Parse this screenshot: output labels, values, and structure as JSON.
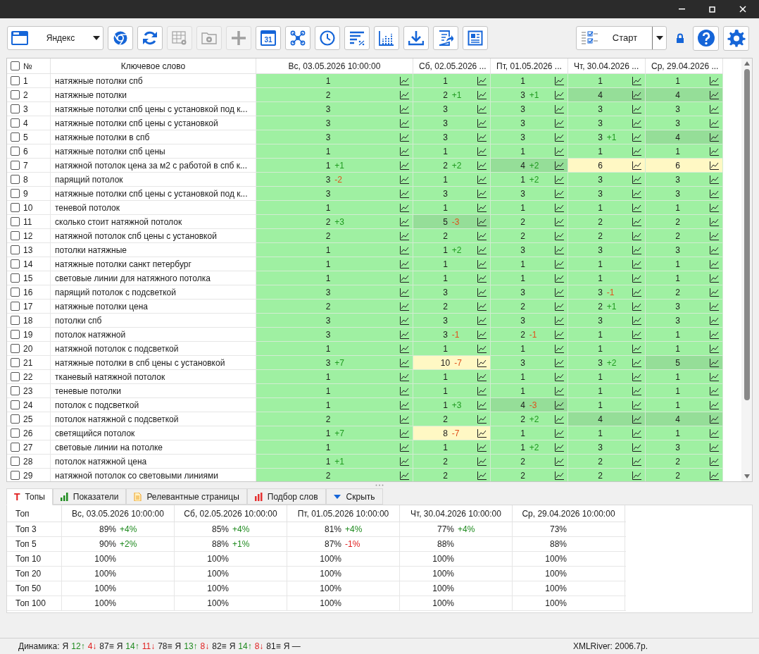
{
  "toolbar": {
    "engine": {
      "label": "Яндекс"
    },
    "buttons": [
      {
        "kind": "browser",
        "disabled": false
      },
      {
        "kind": "refresh",
        "disabled": false
      },
      {
        "kind": "table",
        "disabled": true
      },
      {
        "kind": "folder",
        "disabled": true
      },
      {
        "kind": "plus",
        "disabled": true
      },
      {
        "kind": "calendar",
        "label": "31",
        "disabled": false
      },
      {
        "kind": "network",
        "disabled": false
      },
      {
        "kind": "clock",
        "disabled": false
      },
      {
        "kind": "sort",
        "disabled": false
      },
      {
        "kind": "chart",
        "disabled": false
      },
      {
        "kind": "download",
        "disabled": false
      },
      {
        "kind": "export",
        "disabled": false
      },
      {
        "kind": "newspaper",
        "disabled": false
      }
    ],
    "start": {
      "label": "Старт"
    },
    "right_buttons": [
      {
        "kind": "help"
      },
      {
        "kind": "settings"
      }
    ]
  },
  "table": {
    "header_checked": false,
    "number_header": "№",
    "keyword_header": "Ключевое слово",
    "date_columns": [
      "Вс, 03.05.2026 10:00:00",
      "Сб, 02.05.2026 ...",
      "Пт, 01.05.2026 ...",
      "Чт, 30.04.2026 ...",
      "Ср, 29.04.2026 ..."
    ],
    "rows": [
      {
        "n": "1",
        "keyword": "натяжные потолки спб",
        "checked": false,
        "cells": [
          {
            "v": "1",
            "kind": "green"
          },
          {
            "v": "1",
            "kind": "green"
          },
          {
            "v": "1",
            "kind": "green"
          },
          {
            "v": "1",
            "kind": "green"
          },
          {
            "v": "1",
            "kind": "green"
          }
        ]
      },
      {
        "n": "2",
        "keyword": "натяжные потолки",
        "checked": false,
        "cells": [
          {
            "v": "2",
            "kind": "green"
          },
          {
            "v": "2",
            "d": "+1",
            "up": true,
            "kind": "green"
          },
          {
            "v": "3",
            "d": "+1",
            "up": true,
            "kind": "green"
          },
          {
            "v": "4",
            "kind": "dark"
          },
          {
            "v": "4",
            "kind": "dark"
          }
        ]
      },
      {
        "n": "3",
        "keyword": "натяжные потолки спб цены с установкой под к...",
        "checked": false,
        "cells": [
          {
            "v": "3",
            "kind": "green"
          },
          {
            "v": "3",
            "kind": "green"
          },
          {
            "v": "3",
            "kind": "green"
          },
          {
            "v": "3",
            "kind": "green"
          },
          {
            "v": "3",
            "kind": "green"
          }
        ]
      },
      {
        "n": "4",
        "keyword": "натяжные потолки спб цены с установкой",
        "checked": false,
        "cells": [
          {
            "v": "3",
            "kind": "green"
          },
          {
            "v": "3",
            "kind": "green"
          },
          {
            "v": "3",
            "kind": "green"
          },
          {
            "v": "3",
            "kind": "green"
          },
          {
            "v": "3",
            "kind": "green"
          }
        ]
      },
      {
        "n": "5",
        "keyword": "натяжные потолки в спб",
        "checked": false,
        "cells": [
          {
            "v": "3",
            "kind": "green"
          },
          {
            "v": "3",
            "kind": "green"
          },
          {
            "v": "3",
            "kind": "green"
          },
          {
            "v": "3",
            "d": "+1",
            "up": true,
            "kind": "green"
          },
          {
            "v": "4",
            "kind": "dark"
          }
        ]
      },
      {
        "n": "6",
        "keyword": "натяжные потолки спб цены",
        "checked": false,
        "cells": [
          {
            "v": "1",
            "kind": "green"
          },
          {
            "v": "1",
            "kind": "green"
          },
          {
            "v": "1",
            "kind": "green"
          },
          {
            "v": "1",
            "kind": "green"
          },
          {
            "v": "1",
            "kind": "green"
          }
        ]
      },
      {
        "n": "7",
        "keyword": "натяжной потолок цена за м2 с работой в спб к...",
        "checked": false,
        "cells": [
          {
            "v": "1",
            "d": "+1",
            "up": true,
            "kind": "green"
          },
          {
            "v": "2",
            "d": "+2",
            "up": true,
            "kind": "green"
          },
          {
            "v": "4",
            "d": "+2",
            "up": true,
            "kind": "dark"
          },
          {
            "v": "6",
            "kind": "yellow"
          },
          {
            "v": "6",
            "kind": "yellow"
          }
        ]
      },
      {
        "n": "8",
        "keyword": "парящий потолок",
        "checked": false,
        "cells": [
          {
            "v": "3",
            "d": "-2",
            "up": false,
            "kind": "green"
          },
          {
            "v": "1",
            "kind": "green"
          },
          {
            "v": "1",
            "d": "+2",
            "up": true,
            "kind": "green"
          },
          {
            "v": "3",
            "kind": "green"
          },
          {
            "v": "3",
            "kind": "green"
          }
        ]
      },
      {
        "n": "9",
        "keyword": "натяжные потолки спб цены с установкой под к...",
        "checked": false,
        "cells": [
          {
            "v": "3",
            "kind": "green"
          },
          {
            "v": "3",
            "kind": "green"
          },
          {
            "v": "3",
            "kind": "green"
          },
          {
            "v": "3",
            "kind": "green"
          },
          {
            "v": "3",
            "kind": "green"
          }
        ]
      },
      {
        "n": "10",
        "keyword": "теневой потолок",
        "checked": false,
        "cells": [
          {
            "v": "1",
            "kind": "green"
          },
          {
            "v": "1",
            "kind": "green"
          },
          {
            "v": "1",
            "kind": "green"
          },
          {
            "v": "1",
            "kind": "green"
          },
          {
            "v": "1",
            "kind": "green"
          }
        ]
      },
      {
        "n": "11",
        "keyword": "сколько стоит натяжной потолок",
        "checked": false,
        "cells": [
          {
            "v": "2",
            "d": "+3",
            "up": true,
            "kind": "green"
          },
          {
            "v": "5",
            "d": "-3",
            "up": false,
            "kind": "dark"
          },
          {
            "v": "2",
            "kind": "green"
          },
          {
            "v": "2",
            "kind": "green"
          },
          {
            "v": "2",
            "kind": "green"
          }
        ]
      },
      {
        "n": "12",
        "keyword": "натяжной потолок спб цены с установкой",
        "checked": false,
        "cells": [
          {
            "v": "2",
            "kind": "green"
          },
          {
            "v": "2",
            "kind": "green"
          },
          {
            "v": "2",
            "kind": "green"
          },
          {
            "v": "2",
            "kind": "green"
          },
          {
            "v": "2",
            "kind": "green"
          }
        ]
      },
      {
        "n": "13",
        "keyword": "потолки натяжные",
        "checked": false,
        "cells": [
          {
            "v": "1",
            "kind": "green"
          },
          {
            "v": "1",
            "d": "+2",
            "up": true,
            "kind": "green"
          },
          {
            "v": "3",
            "kind": "green"
          },
          {
            "v": "3",
            "kind": "green"
          },
          {
            "v": "3",
            "kind": "green"
          }
        ]
      },
      {
        "n": "14",
        "keyword": "натяжные потолки санкт петербург",
        "checked": false,
        "cells": [
          {
            "v": "1",
            "kind": "green"
          },
          {
            "v": "1",
            "kind": "green"
          },
          {
            "v": "1",
            "kind": "green"
          },
          {
            "v": "1",
            "kind": "green"
          },
          {
            "v": "1",
            "kind": "green"
          }
        ]
      },
      {
        "n": "15",
        "keyword": "световые линии для натяжного потолка",
        "checked": false,
        "cells": [
          {
            "v": "1",
            "kind": "green"
          },
          {
            "v": "1",
            "kind": "green"
          },
          {
            "v": "1",
            "kind": "green"
          },
          {
            "v": "1",
            "kind": "green"
          },
          {
            "v": "1",
            "kind": "green"
          }
        ]
      },
      {
        "n": "16",
        "keyword": "парящий потолок с подсветкой",
        "checked": false,
        "cells": [
          {
            "v": "3",
            "kind": "green"
          },
          {
            "v": "3",
            "kind": "green"
          },
          {
            "v": "3",
            "kind": "green"
          },
          {
            "v": "3",
            "d": "-1",
            "up": false,
            "kind": "green"
          },
          {
            "v": "2",
            "kind": "green"
          }
        ]
      },
      {
        "n": "17",
        "keyword": "натяжные потолки цена",
        "checked": false,
        "cells": [
          {
            "v": "2",
            "kind": "green"
          },
          {
            "v": "2",
            "kind": "green"
          },
          {
            "v": "2",
            "kind": "green"
          },
          {
            "v": "2",
            "d": "+1",
            "up": true,
            "kind": "green"
          },
          {
            "v": "3",
            "kind": "green"
          }
        ]
      },
      {
        "n": "18",
        "keyword": "потолки спб",
        "checked": false,
        "cells": [
          {
            "v": "3",
            "kind": "green"
          },
          {
            "v": "3",
            "kind": "green"
          },
          {
            "v": "3",
            "kind": "green"
          },
          {
            "v": "3",
            "kind": "green"
          },
          {
            "v": "3",
            "kind": "green"
          }
        ]
      },
      {
        "n": "19",
        "keyword": "потолок натяжной",
        "checked": false,
        "cells": [
          {
            "v": "3",
            "kind": "green"
          },
          {
            "v": "3",
            "d": "-1",
            "up": false,
            "kind": "green"
          },
          {
            "v": "2",
            "d": "-1",
            "up": false,
            "kind": "green"
          },
          {
            "v": "1",
            "kind": "green"
          },
          {
            "v": "1",
            "kind": "green"
          }
        ]
      },
      {
        "n": "20",
        "keyword": "натяжной потолок с подсветкой",
        "checked": false,
        "cells": [
          {
            "v": "1",
            "kind": "green"
          },
          {
            "v": "1",
            "kind": "green"
          },
          {
            "v": "1",
            "kind": "green"
          },
          {
            "v": "1",
            "kind": "green"
          },
          {
            "v": "1",
            "kind": "green"
          }
        ]
      },
      {
        "n": "21",
        "keyword": "натяжные потолки в спб цены с установкой",
        "checked": false,
        "cells": [
          {
            "v": "3",
            "d": "+7",
            "up": true,
            "kind": "green"
          },
          {
            "v": "10",
            "d": "-7",
            "up": false,
            "kind": "yellow"
          },
          {
            "v": "3",
            "kind": "green"
          },
          {
            "v": "3",
            "d": "+2",
            "up": true,
            "kind": "green"
          },
          {
            "v": "5",
            "kind": "dark"
          }
        ]
      },
      {
        "n": "22",
        "keyword": "тканевый натяжной потолок",
        "checked": false,
        "cells": [
          {
            "v": "1",
            "kind": "green"
          },
          {
            "v": "1",
            "kind": "green"
          },
          {
            "v": "1",
            "kind": "green"
          },
          {
            "v": "1",
            "kind": "green"
          },
          {
            "v": "1",
            "kind": "green"
          }
        ]
      },
      {
        "n": "23",
        "keyword": "теневые потолки",
        "checked": false,
        "cells": [
          {
            "v": "1",
            "kind": "green"
          },
          {
            "v": "1",
            "kind": "green"
          },
          {
            "v": "1",
            "kind": "green"
          },
          {
            "v": "1",
            "kind": "green"
          },
          {
            "v": "1",
            "kind": "green"
          }
        ]
      },
      {
        "n": "24",
        "keyword": "потолок с подсветкой",
        "checked": false,
        "cells": [
          {
            "v": "1",
            "kind": "green"
          },
          {
            "v": "1",
            "d": "+3",
            "up": true,
            "kind": "green"
          },
          {
            "v": "4",
            "d": "-3",
            "up": false,
            "kind": "dark"
          },
          {
            "v": "1",
            "kind": "green"
          },
          {
            "v": "1",
            "kind": "green"
          }
        ]
      },
      {
        "n": "25",
        "keyword": "потолок натяжной с подсветкой",
        "checked": false,
        "cells": [
          {
            "v": "2",
            "kind": "green"
          },
          {
            "v": "2",
            "kind": "green"
          },
          {
            "v": "2",
            "d": "+2",
            "up": true,
            "kind": "green"
          },
          {
            "v": "4",
            "kind": "dark"
          },
          {
            "v": "4",
            "kind": "dark"
          }
        ]
      },
      {
        "n": "26",
        "keyword": "светящийся потолок",
        "checked": false,
        "cells": [
          {
            "v": "1",
            "d": "+7",
            "up": true,
            "kind": "green"
          },
          {
            "v": "8",
            "d": "-7",
            "up": false,
            "kind": "yellow"
          },
          {
            "v": "1",
            "kind": "green"
          },
          {
            "v": "1",
            "kind": "green"
          },
          {
            "v": "1",
            "kind": "green"
          }
        ]
      },
      {
        "n": "27",
        "keyword": "световые линии на потолке",
        "checked": false,
        "cells": [
          {
            "v": "1",
            "kind": "green"
          },
          {
            "v": "1",
            "kind": "green"
          },
          {
            "v": "1",
            "d": "+2",
            "up": true,
            "kind": "green"
          },
          {
            "v": "3",
            "kind": "green"
          },
          {
            "v": "3",
            "kind": "green"
          }
        ]
      },
      {
        "n": "28",
        "keyword": "потолок натяжной цена",
        "checked": false,
        "cells": [
          {
            "v": "1",
            "d": "+1",
            "up": true,
            "kind": "green"
          },
          {
            "v": "2",
            "kind": "green"
          },
          {
            "v": "2",
            "kind": "green"
          },
          {
            "v": "2",
            "kind": "green"
          },
          {
            "v": "2",
            "kind": "green"
          }
        ]
      },
      {
        "n": "29",
        "keyword": "натяжной потолок со световыми линиями",
        "checked": false,
        "cells": [
          {
            "v": "2",
            "kind": "green"
          },
          {
            "v": "2",
            "kind": "green"
          },
          {
            "v": "2",
            "kind": "green"
          },
          {
            "v": "2",
            "kind": "green"
          },
          {
            "v": "2",
            "kind": "green"
          }
        ]
      }
    ]
  },
  "bottom_tabs": [
    {
      "label": "Топы",
      "kind": "letter",
      "icon_text": "T",
      "selected": true
    },
    {
      "label": "Показатели",
      "kind": "bars-green",
      "selected": false
    },
    {
      "label": "Релевантные страницы",
      "kind": "page",
      "selected": false
    },
    {
      "label": "Подбор слов",
      "kind": "bars-red",
      "selected": false
    },
    {
      "label": "Скрыть",
      "kind": "triangle",
      "selected": false
    }
  ],
  "tops": {
    "label_header": "Топ",
    "date_columns": [
      "Вс, 03.05.2026 10:00:00",
      "Сб, 02.05.2026 10:00:00",
      "Пт, 01.05.2026 10:00:00",
      "Чт, 30.04.2026 10:00:00",
      "Ср, 29.04.2026 10:00:00"
    ],
    "rows": [
      {
        "label": "Топ 3",
        "cells": [
          {
            "v": "89%",
            "d": "+4%",
            "up": true
          },
          {
            "v": "85%",
            "d": "+4%",
            "up": true
          },
          {
            "v": "81%",
            "d": "+4%",
            "up": true
          },
          {
            "v": "77%",
            "d": "+4%",
            "up": true
          },
          {
            "v": "73%"
          }
        ]
      },
      {
        "label": "Топ 5",
        "cells": [
          {
            "v": "90%",
            "d": "+2%",
            "up": true
          },
          {
            "v": "88%",
            "d": "+1%",
            "up": true
          },
          {
            "v": "87%",
            "d": "-1%",
            "up": false
          },
          {
            "v": "88%"
          },
          {
            "v": "88%"
          }
        ]
      },
      {
        "label": "Топ 10",
        "cells": [
          {
            "v": "100%"
          },
          {
            "v": "100%"
          },
          {
            "v": "100%"
          },
          {
            "v": "100%"
          },
          {
            "v": "100%"
          }
        ]
      },
      {
        "label": "Топ 20",
        "cells": [
          {
            "v": "100%"
          },
          {
            "v": "100%"
          },
          {
            "v": "100%"
          },
          {
            "v": "100%"
          },
          {
            "v": "100%"
          }
        ]
      },
      {
        "label": "Топ 50",
        "cells": [
          {
            "v": "100%"
          },
          {
            "v": "100%"
          },
          {
            "v": "100%"
          },
          {
            "v": "100%"
          },
          {
            "v": "100%"
          }
        ]
      },
      {
        "label": "Топ 100",
        "cells": [
          {
            "v": "100%"
          },
          {
            "v": "100%"
          },
          {
            "v": "100%"
          },
          {
            "v": "100%"
          },
          {
            "v": "100%"
          }
        ]
      }
    ]
  },
  "status_bar": {
    "label": "Динамика:",
    "groups": [
      {
        "engine": "Я",
        "up": "12↑",
        "down": "4↓",
        "same": "87≡"
      },
      {
        "engine": "Я",
        "up": "14↑",
        "down": "11↓",
        "same": "78≡"
      },
      {
        "engine": "Я",
        "up": "13↑",
        "down": "8↓",
        "same": "82≡"
      },
      {
        "engine": "Я",
        "up": "14↑",
        "down": "8↓",
        "same": "81≡"
      }
    ],
    "tail": "Я —",
    "balance": "XMLRiver: 2006.7р."
  }
}
